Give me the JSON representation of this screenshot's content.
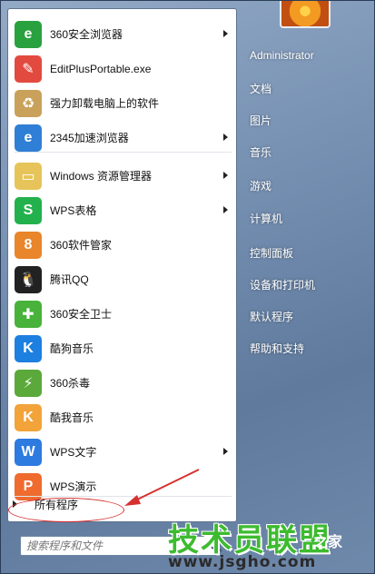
{
  "user": {
    "name": "Administrator"
  },
  "programs": [
    {
      "label": "360安全浏览器",
      "icon": "360-browser-icon",
      "color": "#2aa13f",
      "glyph": "e",
      "submenu": true
    },
    {
      "label": "EditPlusPortable.exe",
      "icon": "editplus-icon",
      "color": "#e34a3f",
      "glyph": "✎",
      "submenu": false
    },
    {
      "label": "强力卸载电脑上的软件",
      "icon": "uninstall-box-icon",
      "color": "#c9a15a",
      "glyph": "♻",
      "submenu": false
    },
    {
      "label": "2345加速浏览器",
      "icon": "2345-browser-icon",
      "color": "#2f7fd6",
      "glyph": "e",
      "submenu": true
    },
    {
      "label": "Windows 资源管理器",
      "icon": "explorer-folder-icon",
      "color": "#e7c45a",
      "glyph": "▭",
      "submenu": true
    },
    {
      "label": "WPS表格",
      "icon": "wps-spreadsheet-icon",
      "color": "#23b14d",
      "glyph": "S",
      "submenu": true
    },
    {
      "label": "360软件管家",
      "icon": "360-software-manager-icon",
      "color": "#e9852b",
      "glyph": "8",
      "submenu": false
    },
    {
      "label": "腾讯QQ",
      "icon": "qq-penguin-icon",
      "color": "#222222",
      "glyph": "🐧",
      "submenu": false
    },
    {
      "label": "360安全卫士",
      "icon": "360-security-icon",
      "color": "#48b23a",
      "glyph": "✚",
      "submenu": false
    },
    {
      "label": "酷狗音乐",
      "icon": "kugou-music-icon",
      "color": "#1d7fe0",
      "glyph": "K",
      "submenu": false
    },
    {
      "label": "360杀毒",
      "icon": "360-antivirus-icon",
      "color": "#5aa93a",
      "glyph": "⚡",
      "submenu": false
    },
    {
      "label": "酷我音乐",
      "icon": "kuwo-music-icon",
      "color": "#f2a33a",
      "glyph": "K",
      "submenu": false
    },
    {
      "label": "WPS文字",
      "icon": "wps-writer-icon",
      "color": "#2d7be0",
      "glyph": "W",
      "submenu": true
    },
    {
      "label": "WPS演示",
      "icon": "wps-presentation-icon",
      "color": "#ef6b2e",
      "glyph": "P",
      "submenu": false
    }
  ],
  "all_programs": {
    "label": "所有程序"
  },
  "search": {
    "placeholder": "搜索程序和文件"
  },
  "right_pane": [
    "文档",
    "图片",
    "音乐",
    "游戏",
    "计算机",
    "控制面板",
    "设备和打印机",
    "默认程序",
    "帮助和支持"
  ],
  "watermark": {
    "main": "技术员联盟",
    "url": "www.jsgho.com",
    "suffix": "之家"
  }
}
